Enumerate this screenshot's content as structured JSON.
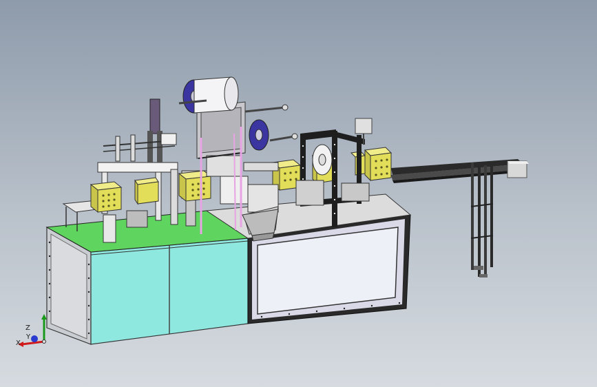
{
  "viewport": {
    "background_top": "#8e9bab",
    "background_bottom": "#d6dbe0"
  },
  "model": {
    "panel_color": "#8fe8e0",
    "deck_color": "#5fd45f",
    "block_color": "#e3de5a",
    "frame_color": "#1e1e1e",
    "reel_color": "#3a35a0"
  },
  "triad": {
    "z_label": "Z",
    "y_label": "Y",
    "x_label": "X",
    "z_color": "#1a9a1a",
    "y_color": "#2b3bd0",
    "x_color": "#d01a1a"
  }
}
